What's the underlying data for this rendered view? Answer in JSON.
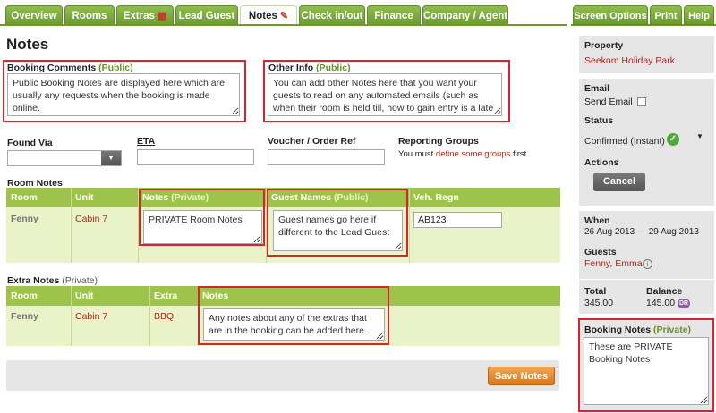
{
  "tabs": [
    {
      "label": "Overview",
      "icon": ""
    },
    {
      "label": "Rooms",
      "icon": ""
    },
    {
      "label": "Extras",
      "icon": "extras-icon"
    },
    {
      "label": "Lead Guest",
      "icon": ""
    },
    {
      "label": "Notes",
      "icon": "notes-icon"
    },
    {
      "label": "Check in/out",
      "icon": ""
    },
    {
      "label": "Finance",
      "icon": ""
    },
    {
      "label": "Company / Agent",
      "icon": ""
    }
  ],
  "right_tabs": [
    "Screen Options",
    "Print",
    "Help"
  ],
  "page_title": "Notes",
  "booking_comments": {
    "label": "Booking Comments",
    "tag": "(Public)",
    "value": "Public Booking Notes are displayed here which are usually any requests when the booking is made online."
  },
  "other_info": {
    "label": "Other Info",
    "tag": "(Public)",
    "value": "You can add other Notes here that you want your guests to read on any automated emails (such as when their room is held till, how to gain entry is a late arrival, etc)"
  },
  "fields": {
    "found_via": "Found Via",
    "eta": "ETA",
    "voucher": "Voucher / Order Ref",
    "reporting_groups": "Reporting Groups",
    "reporting_prefix": "You must ",
    "reporting_link": "define some groups",
    "reporting_suffix": " first."
  },
  "room_notes": {
    "title": "Room Notes",
    "headers": {
      "room": "Room",
      "unit": "Unit",
      "notes": "Notes",
      "notes_tag": "(Private)",
      "guest_names": "Guest Names",
      "guest_tag": "(Public)",
      "veh": "Veh. Regn"
    },
    "row": {
      "room": "Fenny",
      "unit": "Cabin 7",
      "notes": "PRIVATE Room Notes",
      "guest_names": "Guest names go here if different to the Lead Guest",
      "veh": "AB123"
    }
  },
  "extra_notes": {
    "title": "Extra Notes",
    "tag": "(Private)",
    "headers": {
      "room": "Room",
      "unit": "Unit",
      "extra": "Extra",
      "notes": "Notes"
    },
    "row": {
      "room": "Fenny",
      "unit": "Cabin 7",
      "extra": "BBQ",
      "notes": "Any notes about any of the extras that are in the booking can be added here."
    }
  },
  "save_label": "Save Notes",
  "sidebar": {
    "property_label": "Property",
    "property_value": "Seekom Holiday Park",
    "email_label": "Email",
    "send_email": "Send Email",
    "status_label": "Status",
    "status_value": "Confirmed (Instant)",
    "actions_label": "Actions",
    "cancel_label": "Cancel",
    "when_label": "When",
    "when_value": "26 Aug 2013 — 29 Aug 2013",
    "guests_label": "Guests",
    "guests_value": "Fenny, Emma",
    "total_label": "Total",
    "total_value": "345.00",
    "balance_label": "Balance",
    "balance_value": "145.00",
    "balance_badge": "DR",
    "booking_notes_label": "Booking Notes",
    "booking_notes_tag": "(Private)",
    "booking_notes_value": "These are PRIVATE Booking Notes"
  },
  "colors": {
    "accent": "#6c9a2f",
    "highlight": "#d8242e",
    "link": "#b3261e",
    "save": "#e08a2e"
  }
}
